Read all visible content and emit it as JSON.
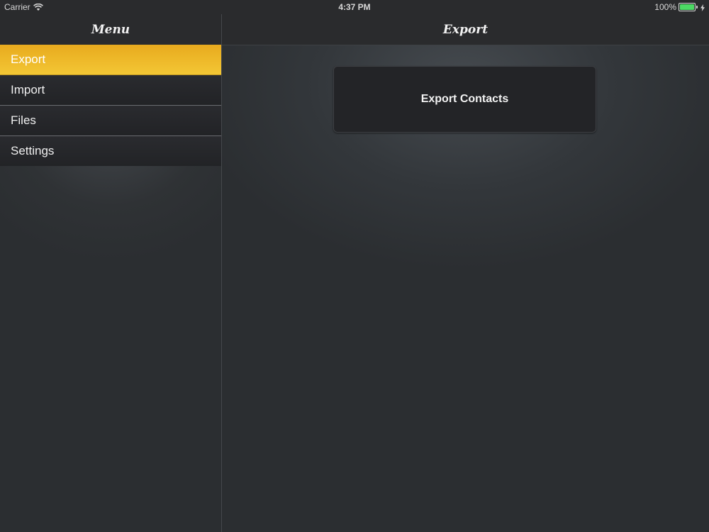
{
  "status_bar": {
    "carrier": "Carrier",
    "time": "4:37 PM",
    "battery": "100%",
    "battery_color": "#4cd964"
  },
  "sidebar": {
    "title": "Menu",
    "items": [
      {
        "label": "Export",
        "selected": true
      },
      {
        "label": "Import",
        "selected": false
      },
      {
        "label": "Files",
        "selected": false
      },
      {
        "label": "Settings",
        "selected": false
      }
    ],
    "accent_color": "#f0bd2d"
  },
  "main": {
    "title": "Export",
    "export_button_label": "Export Contacts"
  },
  "icons": [
    "wifi-icon",
    "battery-icon",
    "charging-icon"
  ]
}
